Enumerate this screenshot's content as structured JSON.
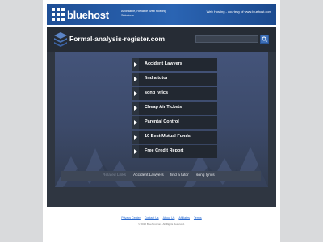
{
  "banner": {
    "brand": "bluehost",
    "tagline": "Affordable, Reliable Web Hosting Solutions",
    "right_text": "Web Hosting - courtesy of www.bluehost.com"
  },
  "header": {
    "site_title": "Formal-analysis-register.com",
    "search_placeholder": ""
  },
  "links": [
    {
      "label": "Accident Lawyers"
    },
    {
      "label": "find a tutor"
    },
    {
      "label": "song lyrics"
    },
    {
      "label": "Cheap Air Tickets"
    },
    {
      "label": "Parental Control"
    },
    {
      "label": "10 Best Mutual Funds"
    },
    {
      "label": "Free Credit Report"
    }
  ],
  "related": {
    "label": "Related Links",
    "links": [
      "Accident Lawyers",
      "find a tutor",
      "song lyrics"
    ]
  },
  "footer": {
    "links": [
      "Privacy Center",
      "Contact Us",
      "About Us",
      "Affiliates",
      "Terms"
    ],
    "copyright": "© 2012 Bluehost.com. All Rights Reserved."
  },
  "colors": {
    "banner_blue": "#2a64b3",
    "panel_dark": "#2f3641",
    "content_blue": "#44547a",
    "footer_link": "#2a6bd1"
  }
}
